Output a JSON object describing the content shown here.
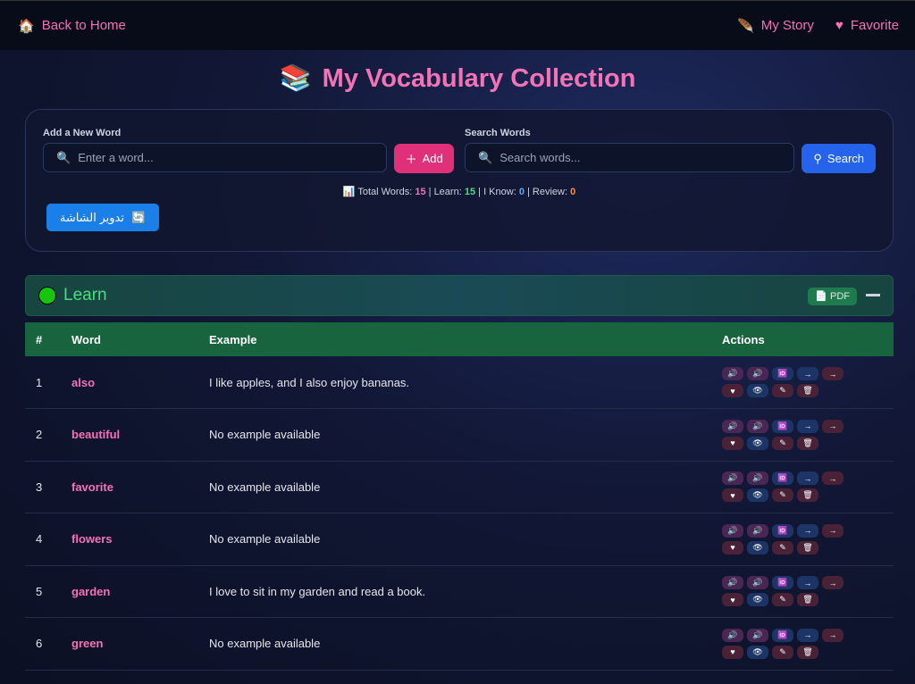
{
  "nav": {
    "back": "Back to Home",
    "story": "My Story",
    "favorite": "Favorite"
  },
  "title": "My Vocabulary Collection",
  "add": {
    "label": "Add a New Word",
    "placeholder": "Enter a word...",
    "button": "Add"
  },
  "search": {
    "label": "Search Words",
    "placeholder": "Search words...",
    "button": "Search"
  },
  "stats": {
    "total_label": "Total Words:",
    "total": "15",
    "learn_label": "Learn:",
    "learn": "15",
    "know_label": "I Know:",
    "know": "0",
    "review_label": "Review:",
    "review": "0"
  },
  "rotate_button": "تدوير الشاشة",
  "section": {
    "title": "Learn",
    "pdf": "PDF"
  },
  "table": {
    "headers": [
      "#",
      "Word",
      "Example",
      "Actions"
    ],
    "rows": [
      {
        "n": "1",
        "word": "also",
        "example": "I like apples, and I also enjoy bananas."
      },
      {
        "n": "2",
        "word": "beautiful",
        "example": "No example available"
      },
      {
        "n": "3",
        "word": "favorite",
        "example": "No example available"
      },
      {
        "n": "4",
        "word": "flowers",
        "example": "No example available"
      },
      {
        "n": "5",
        "word": "garden",
        "example": "I love to sit in my garden and read a book."
      },
      {
        "n": "6",
        "word": "green",
        "example": "No example available"
      }
    ]
  }
}
